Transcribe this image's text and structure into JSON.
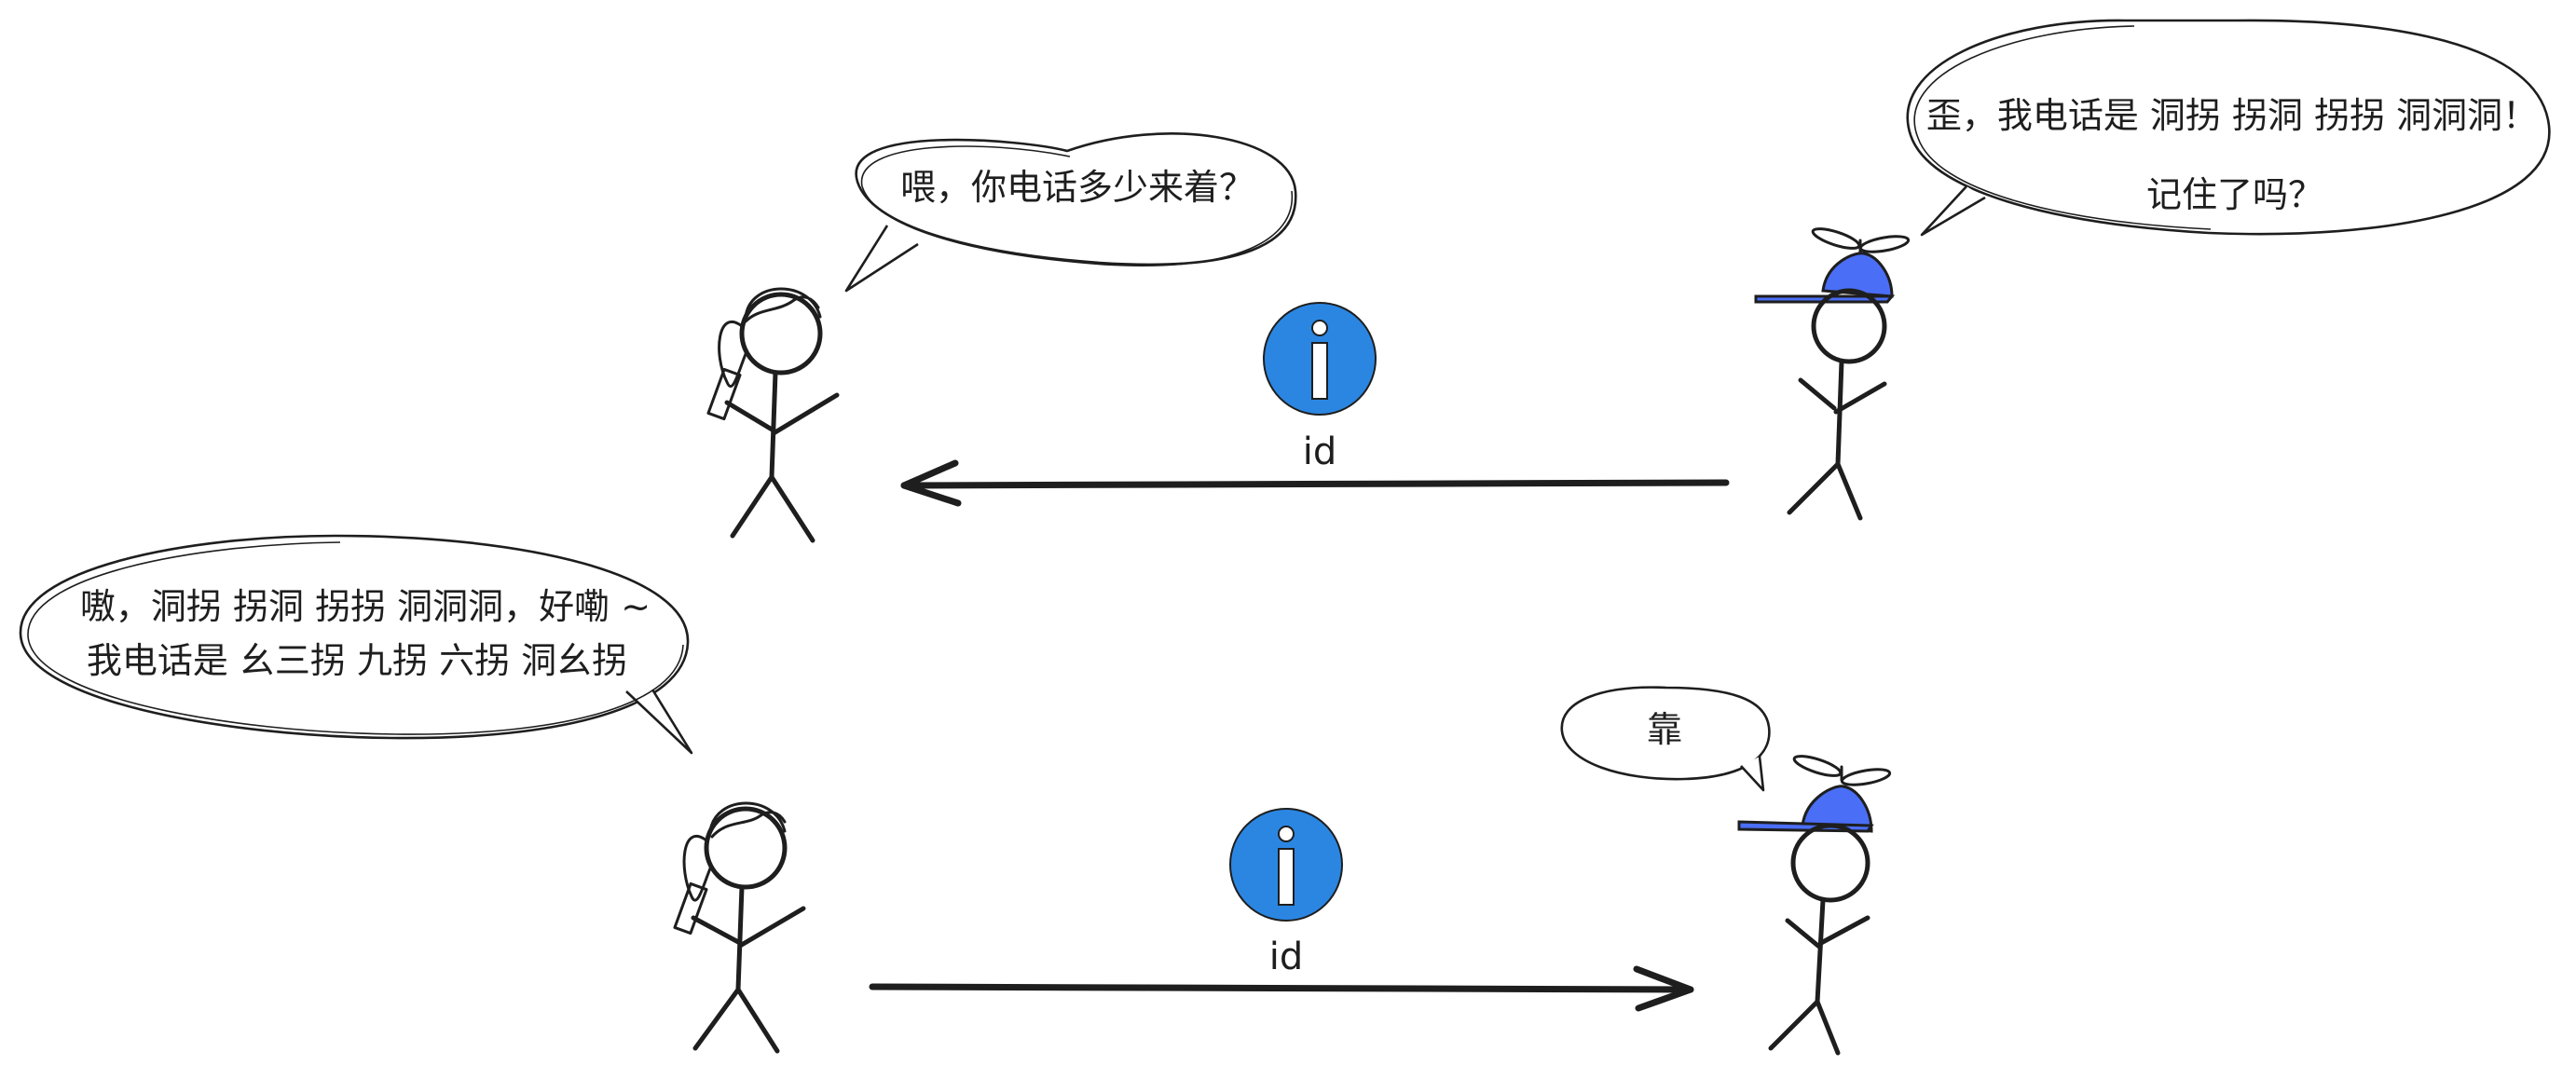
{
  "colors": {
    "ink": "#1e1e1e",
    "info_blue": "#2b86e2",
    "cap_blue": "#4a6ef5"
  },
  "scene1": {
    "girl_bubble": "喂，你电话多少来着？",
    "boy_bubble_line1": "歪，我电话是 洞拐 拐洞 拐拐 洞洞洞！",
    "boy_bubble_line2": "记住了吗？",
    "message_label": "id",
    "message_icon": "info-icon",
    "arrow_direction": "right-to-left"
  },
  "scene2": {
    "girl_bubble_line1": "嗷，洞拐 拐洞 拐拐 洞洞洞，好嘞 ~",
    "girl_bubble_line2": "我电话是 幺三拐 九拐 六拐 洞幺拐",
    "boy_bubble": "靠",
    "message_label": "id",
    "message_icon": "info-icon",
    "arrow_direction": "left-to-right"
  }
}
